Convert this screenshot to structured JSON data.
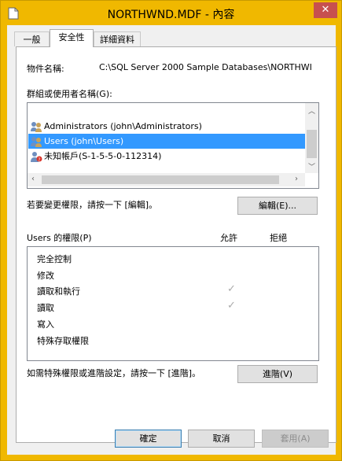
{
  "window": {
    "title": "NORTHWND.MDF - 內容",
    "close_glyph": "✕"
  },
  "tabs": [
    {
      "label": "一般"
    },
    {
      "label": "安全性"
    },
    {
      "label": "詳細資料"
    }
  ],
  "object": {
    "label": "物件名稱:",
    "value": "C:\\SQL Server 2000 Sample Databases\\NORTHWI"
  },
  "groups": {
    "label": "群組或使用者名稱(G):",
    "items": [
      {
        "icon": "user-group-icon",
        "text": "Administrators (john\\Administrators)"
      },
      {
        "icon": "user-group-icon",
        "text": "Users (john\\Users)"
      },
      {
        "icon": "unknown-user-icon",
        "text": "未知帳戶(S-1-5-5-0-112314)"
      }
    ]
  },
  "edit": {
    "hint": "若要變更權限，請按一下 [編輯]。",
    "button": "編輯(E)..."
  },
  "permissions": {
    "title": "Users 的權限(P)",
    "allow_header": "允許",
    "deny_header": "拒絕",
    "check_glyph": "✓",
    "rows": [
      {
        "name": "完全控制",
        "allow": false,
        "deny": false
      },
      {
        "name": "修改",
        "allow": false,
        "deny": false
      },
      {
        "name": "讀取和執行",
        "allow": true,
        "deny": false
      },
      {
        "name": "讀取",
        "allow": true,
        "deny": false
      },
      {
        "name": "寫入",
        "allow": false,
        "deny": false
      },
      {
        "name": "特殊存取權限",
        "allow": false,
        "deny": false
      }
    ]
  },
  "advanced": {
    "hint": "如需特殊權限或進階設定，請按一下 [進階]。",
    "button": "進階(V)"
  },
  "footer": {
    "ok": "確定",
    "cancel": "取消",
    "apply": "套用(A)"
  },
  "colors": {
    "selection": "#3399ff",
    "titlebar": "#f0b800",
    "close": "#c7504f"
  }
}
